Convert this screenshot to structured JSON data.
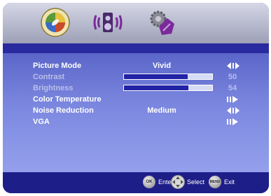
{
  "tabs": [
    {
      "name": "picture",
      "icon": "picture-palette-icon"
    },
    {
      "name": "sound",
      "icon": "speaker-icon"
    },
    {
      "name": "setup",
      "icon": "setup-gear-icon"
    }
  ],
  "menu": {
    "picture_mode": {
      "label": "Picture Mode",
      "value": "Vivid"
    },
    "contrast": {
      "label": "Contrast",
      "value": "50",
      "level": 0.72
    },
    "brightness": {
      "label": "Brightness",
      "value": "54",
      "level": 0.73
    },
    "color_temperature": {
      "label": "Color Temperature"
    },
    "noise_reduction": {
      "label": "Noise Reduction",
      "value": "Medium"
    },
    "vga": {
      "label": "VGA"
    }
  },
  "footer": {
    "ok_button": "OK",
    "enter_label": "Enter",
    "select_label": "Select",
    "menu_button": "MENU",
    "exit_label": "Exit"
  },
  "colors": {
    "panel": "#1e1e88",
    "menu_top": "#5b66c9",
    "menu_bottom": "#94a0ec",
    "slider_fill": "#2323a6"
  }
}
